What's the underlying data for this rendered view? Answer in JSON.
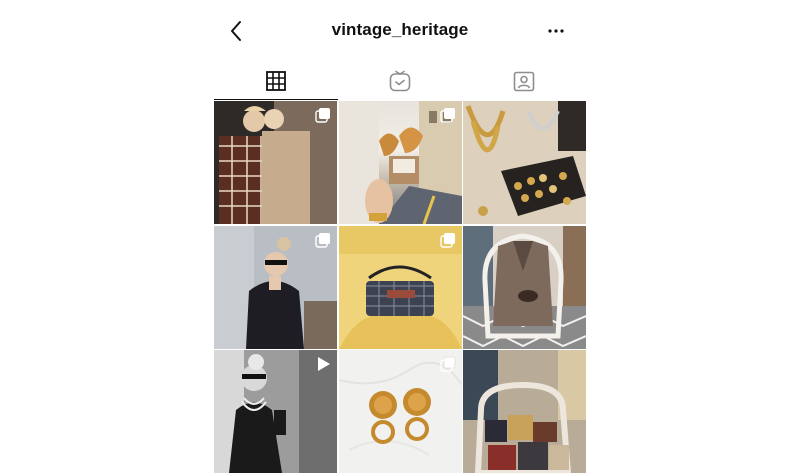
{
  "header": {
    "title": "vintage_heritage",
    "back_icon": "chevron-left-icon",
    "more_icon": "ellipsis-icon"
  },
  "tabs": [
    {
      "icon": "grid-icon",
      "active": true
    },
    {
      "icon": "igtv-icon",
      "active": false
    },
    {
      "icon": "tagged-user-icon",
      "active": false
    }
  ],
  "grid": {
    "posts": [
      {
        "subject": "woman in plaid coat and trench coat",
        "badge": "carousel-icon"
      },
      {
        "subject": "croissants held on street",
        "badge": "carousel-icon"
      },
      {
        "subject": "gold vintage jewelry display",
        "badge": ""
      },
      {
        "subject": "woman in black tweed jacket",
        "badge": "carousel-icon"
      },
      {
        "subject": "grey monogram handbag on yellow chair",
        "badge": "carousel-icon"
      },
      {
        "subject": "houndstooth jacket on chair",
        "badge": ""
      },
      {
        "subject": "black and white woman with pearls",
        "badge": "video-play-icon"
      },
      {
        "subject": "gold lion head earrings",
        "badge": "carousel-icon"
      },
      {
        "subject": "vintage handbags on armchair",
        "badge": ""
      }
    ]
  },
  "colors": {
    "text": "#111111",
    "background": "#ffffff",
    "active_tab_indicator": "#111111"
  }
}
